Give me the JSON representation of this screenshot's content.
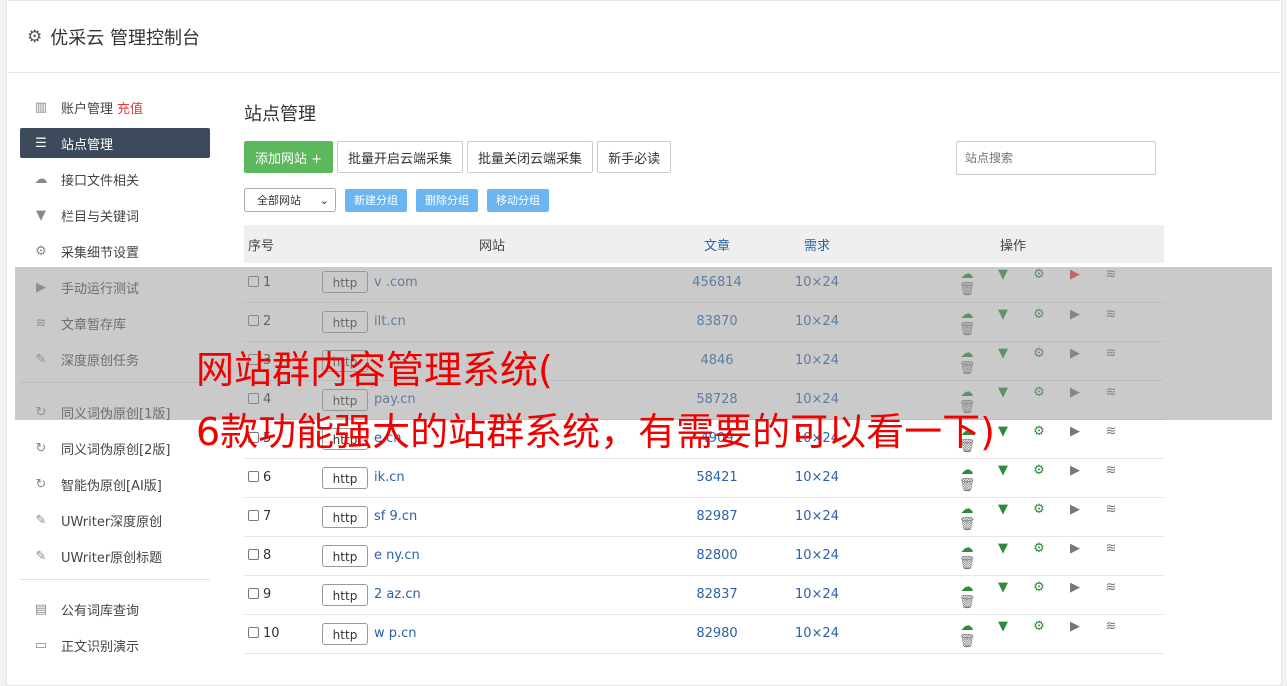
{
  "header": {
    "title": "优采云 管理控制台",
    "icon": "gear-icon"
  },
  "sidebar": {
    "groups": [
      [
        {
          "label": "账户管理",
          "badge": "充值",
          "icon": "bar-chart-icon",
          "active": false
        },
        {
          "label": "站点管理",
          "icon": "server-icon",
          "active": true
        },
        {
          "label": "接口文件相关",
          "icon": "cloud-upload-icon",
          "active": false
        },
        {
          "label": "栏目与关键词",
          "icon": "filter-icon",
          "active": false
        },
        {
          "label": "采集细节设置",
          "icon": "gears-icon",
          "active": false
        },
        {
          "label": "手动运行测试",
          "icon": "play-circle-icon",
          "active": false
        },
        {
          "label": "文章暂存库",
          "icon": "database-icon",
          "active": false
        },
        {
          "label": "深度原创任务",
          "icon": "edit-icon",
          "active": false
        }
      ],
      [
        {
          "label": "同义词伪原创[1版]",
          "icon": "refresh-icon"
        },
        {
          "label": "同义词伪原创[2版]",
          "icon": "refresh-icon"
        },
        {
          "label": "智能伪原创[AI版]",
          "icon": "refresh-icon"
        },
        {
          "label": "UWriter深度原创",
          "icon": "edit-icon"
        },
        {
          "label": "UWriter原创标题",
          "icon": "edit-icon"
        }
      ],
      [
        {
          "label": "公有词库查询",
          "icon": "book-icon"
        },
        {
          "label": "正文识别演示",
          "icon": "monitor-icon"
        }
      ]
    ]
  },
  "main": {
    "title": "站点管理",
    "toolbar": {
      "add_site": "添加网站 +",
      "batch_open": "批量开启云端采集",
      "batch_close": "批量关闭云端采集",
      "newbie": "新手必读",
      "search_placeholder": "站点搜索"
    },
    "group_bar": {
      "select_value": "全部网站",
      "new_group": "新建分组",
      "delete_group": "删除分组",
      "move_group": "移动分组"
    },
    "table": {
      "headers": {
        "no": "序号",
        "site": "网站",
        "articles": "文章",
        "demand": "需求",
        "ops": "操作"
      },
      "rows": [
        {
          "no": "1",
          "scheme": "http",
          "domain": "v        .com",
          "articles": "456814",
          "demand": "10×24",
          "play_active": true
        },
        {
          "no": "2",
          "scheme": "http",
          "domain": "     ilt.cn",
          "articles": "83870",
          "demand": "10×24",
          "play_active": false
        },
        {
          "no": "3",
          "scheme": "http",
          "domain": "",
          "articles": "4846",
          "demand": "10×24",
          "play_active": false
        },
        {
          "no": "4",
          "scheme": "http",
          "domain": "     pay.cn",
          "articles": "58728",
          "demand": "10×24",
          "play_active": false
        },
        {
          "no": "5",
          "scheme": "http",
          "domain": "      e.cn",
          "articles": "4909",
          "demand": "10×24",
          "play_active": false
        },
        {
          "no": "6",
          "scheme": "http",
          "domain": "    ik.cn",
          "articles": "58421",
          "demand": "10×24",
          "play_active": false
        },
        {
          "no": "7",
          "scheme": "http",
          "domain": "sf   9.cn",
          "articles": "82987",
          "demand": "10×24",
          "play_active": false
        },
        {
          "no": "8",
          "scheme": "http",
          "domain": "e     ny.cn",
          "articles": "82800",
          "demand": "10×24",
          "play_active": false
        },
        {
          "no": "9",
          "scheme": "http",
          "domain": "2     az.cn",
          "articles": "82837",
          "demand": "10×24",
          "play_active": false
        },
        {
          "no": "10",
          "scheme": "http",
          "domain": "w    p.cn",
          "articles": "82980",
          "demand": "10×24",
          "play_active": false
        }
      ]
    }
  },
  "overlay": {
    "line1": "网站群内容管理系统(",
    "line2": "6款功能强大的站群系统，有需要的可以看一下)",
    "color": "#f20000"
  }
}
